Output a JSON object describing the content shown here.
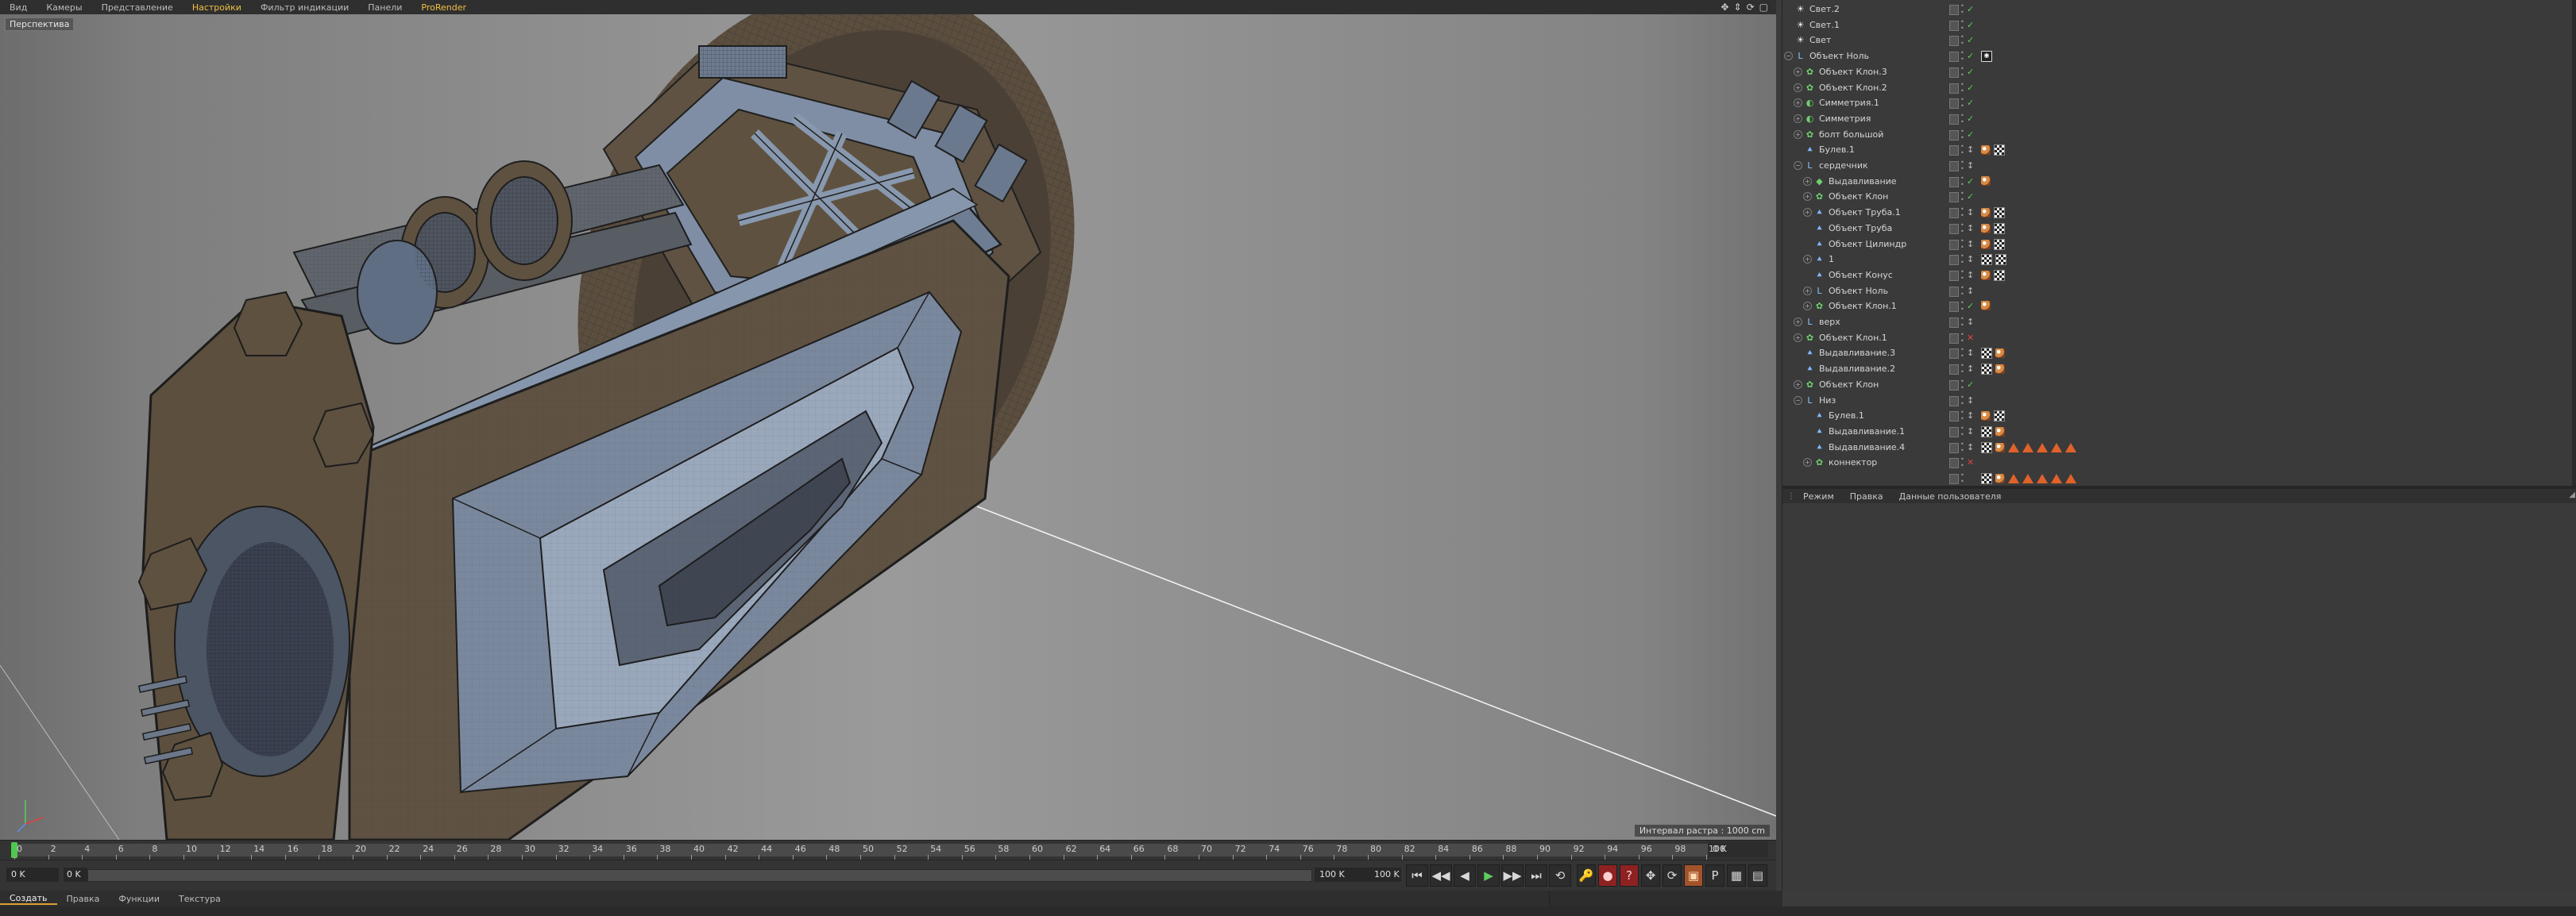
{
  "viewport": {
    "menu": [
      "Вид",
      "Камеры",
      "Представление",
      "Настройки",
      "Фильтр индикации",
      "Панели",
      "ProRender"
    ],
    "highlighted_menu": [
      "Настройки",
      "ProRender"
    ],
    "nav_icons": [
      "move-icon",
      "zoom-icon",
      "rotate-icon",
      "maximize-icon"
    ],
    "nav_glyphs": [
      "✥",
      "⇕",
      "⟳",
      "▢"
    ],
    "camera_label": "Перспектива",
    "grid_status": "Интервал растра : 1000 cm"
  },
  "timeline": {
    "ticks": [
      "0",
      "2",
      "4",
      "6",
      "8",
      "10",
      "12",
      "14",
      "16",
      "18",
      "20",
      "22",
      "24",
      "26",
      "28",
      "30",
      "32",
      "34",
      "36",
      "38",
      "40",
      "42",
      "44",
      "46",
      "48",
      "50",
      "52",
      "54",
      "56",
      "58",
      "60",
      "62",
      "64",
      "66",
      "68",
      "70",
      "72",
      "74",
      "76",
      "78",
      "80",
      "82",
      "84",
      "86",
      "88",
      "90",
      "92",
      "94",
      "96",
      "98",
      "100"
    ],
    "end_field": "0 K"
  },
  "transport": {
    "current_frame": "0 K",
    "range_start": "0 K",
    "range_end": "100 K",
    "range_end_2": "100 K",
    "buttons": [
      "⏮",
      "◀◀",
      "◀",
      "▶",
      "▶▶",
      "⏭",
      "⟲"
    ],
    "tools": [
      "🔑",
      "●",
      "?",
      "✥",
      "⟳",
      "▣",
      "P",
      "▦",
      "▤"
    ]
  },
  "bottom_tabs": [
    "Создать",
    "Правка",
    "Функции",
    "Текстура"
  ],
  "object_manager": {
    "rows": [
      {
        "name": "Свет.2",
        "icon": "light-icon",
        "glyph": "☀",
        "indent": 0,
        "exp": false,
        "check": "✓",
        "check_color": "#5ecb5e",
        "tags": []
      },
      {
        "name": "Свет.1",
        "icon": "light-icon",
        "glyph": "☀",
        "indent": 0,
        "exp": false,
        "check": "✓",
        "check_color": "#5ecb5e",
        "tags": []
      },
      {
        "name": "Свет",
        "icon": "light-icon",
        "glyph": "☀",
        "indent": 0,
        "exp": false,
        "check": "✓",
        "check_color": "#5ecb5e",
        "tags": []
      },
      {
        "name": "Объект Ноль",
        "icon": "null-icon",
        "glyph": "L",
        "indent": 0,
        "exp": true,
        "exp_sign": "−",
        "check": "✓",
        "check_color": "#5ecb5e",
        "tags": [
          "target"
        ]
      },
      {
        "name": "Объект Клон.3",
        "icon": "cloner-icon",
        "glyph": "✿",
        "indent": 1,
        "exp": true,
        "exp_sign": "+",
        "check": "✓",
        "check_color": "#5ecb5e",
        "tags": []
      },
      {
        "name": "Объект Клон.2",
        "icon": "cloner-icon",
        "glyph": "✿",
        "indent": 1,
        "exp": true,
        "exp_sign": "+",
        "check": "✓",
        "check_color": "#5ecb5e",
        "tags": []
      },
      {
        "name": "Симметрия.1",
        "icon": "symmetry-icon",
        "glyph": "◐",
        "indent": 1,
        "exp": true,
        "exp_sign": "+",
        "check": "✓",
        "check_color": "#5ecb5e",
        "tags": []
      },
      {
        "name": "Симметрия",
        "icon": "symmetry-icon",
        "glyph": "◐",
        "indent": 1,
        "exp": true,
        "exp_sign": "+",
        "check": "✓",
        "check_color": "#5ecb5e",
        "tags": []
      },
      {
        "name": "болт большой",
        "icon": "cloner-icon",
        "glyph": "✿",
        "indent": 1,
        "exp": true,
        "exp_sign": "+",
        "check": "✓",
        "check_color": "#5ecb5e",
        "tags": []
      },
      {
        "name": "Булев.1",
        "icon": "poly-icon",
        "glyph": "⯅",
        "indent": 1,
        "exp": false,
        "check": "↕",
        "check_color": "#bbbbbb",
        "tags": [
          "phong",
          "checker"
        ]
      },
      {
        "name": "сердечник",
        "icon": "null-icon",
        "glyph": "L",
        "indent": 1,
        "exp": true,
        "exp_sign": "−",
        "check": "↕",
        "check_color": "#bbbbbb",
        "tags": []
      },
      {
        "name": "Выдавливание",
        "icon": "extrude-icon",
        "glyph": "◆",
        "indent": 2,
        "exp": true,
        "exp_sign": "+",
        "check": "✓",
        "check_color": "#5ecb5e",
        "tags": [
          "phong"
        ]
      },
      {
        "name": "Объект Клон",
        "icon": "cloner-icon",
        "glyph": "✿",
        "indent": 2,
        "exp": true,
        "exp_sign": "+",
        "check": "✓",
        "check_color": "#5ecb5e",
        "tags": []
      },
      {
        "name": "Объект Труба.1",
        "icon": "poly-icon",
        "glyph": "⯅",
        "indent": 2,
        "exp": true,
        "exp_sign": "+",
        "check": "↕",
        "check_color": "#bbbbbb",
        "tags": [
          "phong",
          "checker"
        ]
      },
      {
        "name": "Объект Труба",
        "icon": "poly-icon",
        "glyph": "⯅",
        "indent": 2,
        "exp": false,
        "check": "↕",
        "check_color": "#bbbbbb",
        "tags": [
          "phong",
          "checker"
        ]
      },
      {
        "name": "Объект Цилиндр",
        "icon": "poly-icon",
        "glyph": "⯅",
        "indent": 2,
        "exp": false,
        "check": "↕",
        "check_color": "#bbbbbb",
        "tags": [
          "phong",
          "checker"
        ]
      },
      {
        "name": "1",
        "icon": "poly-icon",
        "glyph": "⯅",
        "indent": 2,
        "exp": true,
        "exp_sign": "+",
        "check": "↕",
        "check_color": "#bbbbbb",
        "tags": [
          "checker",
          "checker"
        ]
      },
      {
        "name": "Объект Конус",
        "icon": "poly-icon",
        "glyph": "⯅",
        "indent": 2,
        "exp": false,
        "check": "↕",
        "check_color": "#bbbbbb",
        "tags": [
          "phong",
          "checker"
        ]
      },
      {
        "name": "Объект Ноль",
        "icon": "null-icon",
        "glyph": "L",
        "indent": 2,
        "exp": true,
        "exp_sign": "+",
        "check": "↕",
        "check_color": "#bbbbbb",
        "tags": []
      },
      {
        "name": "Объект Клон.1",
        "icon": "cloner-icon",
        "glyph": "✿",
        "indent": 2,
        "exp": true,
        "exp_sign": "+",
        "check": "✓",
        "check_color": "#5ecb5e",
        "tags": [
          "phong"
        ]
      },
      {
        "name": "верх",
        "icon": "null-icon",
        "glyph": "L",
        "indent": 1,
        "exp": true,
        "exp_sign": "+",
        "check": "↕",
        "check_color": "#bbbbbb",
        "tags": []
      },
      {
        "name": "Объект Клон.1",
        "icon": "cloner-icon",
        "glyph": "✿",
        "indent": 1,
        "exp": true,
        "exp_sign": "+",
        "check": "✕",
        "check_color": "#e04040",
        "tags": []
      },
      {
        "name": "Выдавливание.3",
        "icon": "poly-icon",
        "glyph": "⯅",
        "indent": 1,
        "exp": false,
        "check": "↕",
        "check_color": "#bbbbbb",
        "tags": [
          "checker",
          "phong"
        ]
      },
      {
        "name": "Выдавливание.2",
        "icon": "poly-icon",
        "glyph": "⯅",
        "indent": 1,
        "exp": false,
        "check": "↕",
        "check_color": "#bbbbbb",
        "tags": [
          "checker",
          "phong"
        ]
      },
      {
        "name": "Объект Клон",
        "icon": "cloner-icon",
        "glyph": "✿",
        "indent": 1,
        "exp": true,
        "exp_sign": "+",
        "check": "✓",
        "check_color": "#5ecb5e",
        "tags": []
      },
      {
        "name": "Низ",
        "icon": "null-icon",
        "glyph": "L",
        "indent": 1,
        "exp": true,
        "exp_sign": "−",
        "check": "↕",
        "check_color": "#bbbbbb",
        "tags": []
      },
      {
        "name": "Булев.1",
        "icon": "poly-icon",
        "glyph": "⯅",
        "indent": 2,
        "exp": false,
        "check": "↕",
        "check_color": "#bbbbbb",
        "tags": [
          "phong",
          "checker"
        ]
      },
      {
        "name": "Выдавливание.1",
        "icon": "poly-icon",
        "glyph": "⯅",
        "indent": 2,
        "exp": false,
        "check": "↕",
        "check_color": "#bbbbbb",
        "tags": [
          "checker",
          "phong"
        ]
      },
      {
        "name": "Выдавливание.4",
        "icon": "poly-icon",
        "glyph": "⯅",
        "indent": 2,
        "exp": false,
        "check": "↕",
        "check_color": "#bbbbbb",
        "tags": [
          "checker",
          "phong",
          "tri",
          "tri",
          "tri",
          "tri",
          "tri"
        ]
      },
      {
        "name": "коннектор",
        "icon": "connector-icon",
        "glyph": "✿",
        "indent": 2,
        "exp": true,
        "exp_sign": "+",
        "check": "✕",
        "check_color": "#e04040",
        "tags": []
      },
      {
        "name": "",
        "icon": "poly-icon",
        "glyph": "",
        "indent": 2,
        "exp": false,
        "check": "",
        "check_color": "#bbbbbb",
        "tags": [
          "checker",
          "phong",
          "tri",
          "tri",
          "tri",
          "tri",
          "tri"
        ]
      }
    ]
  },
  "attribute_manager": {
    "tabs": [
      "Режим",
      "Правка",
      "Данные пользователя"
    ]
  },
  "colors": {
    "viewport_bg": "#8a8a8a",
    "model_face_brown": "#5e5140",
    "model_face_blue": "#6e7c92",
    "accent": "#f0c040",
    "check_green": "#5ecb5e",
    "check_red": "#e04040"
  }
}
